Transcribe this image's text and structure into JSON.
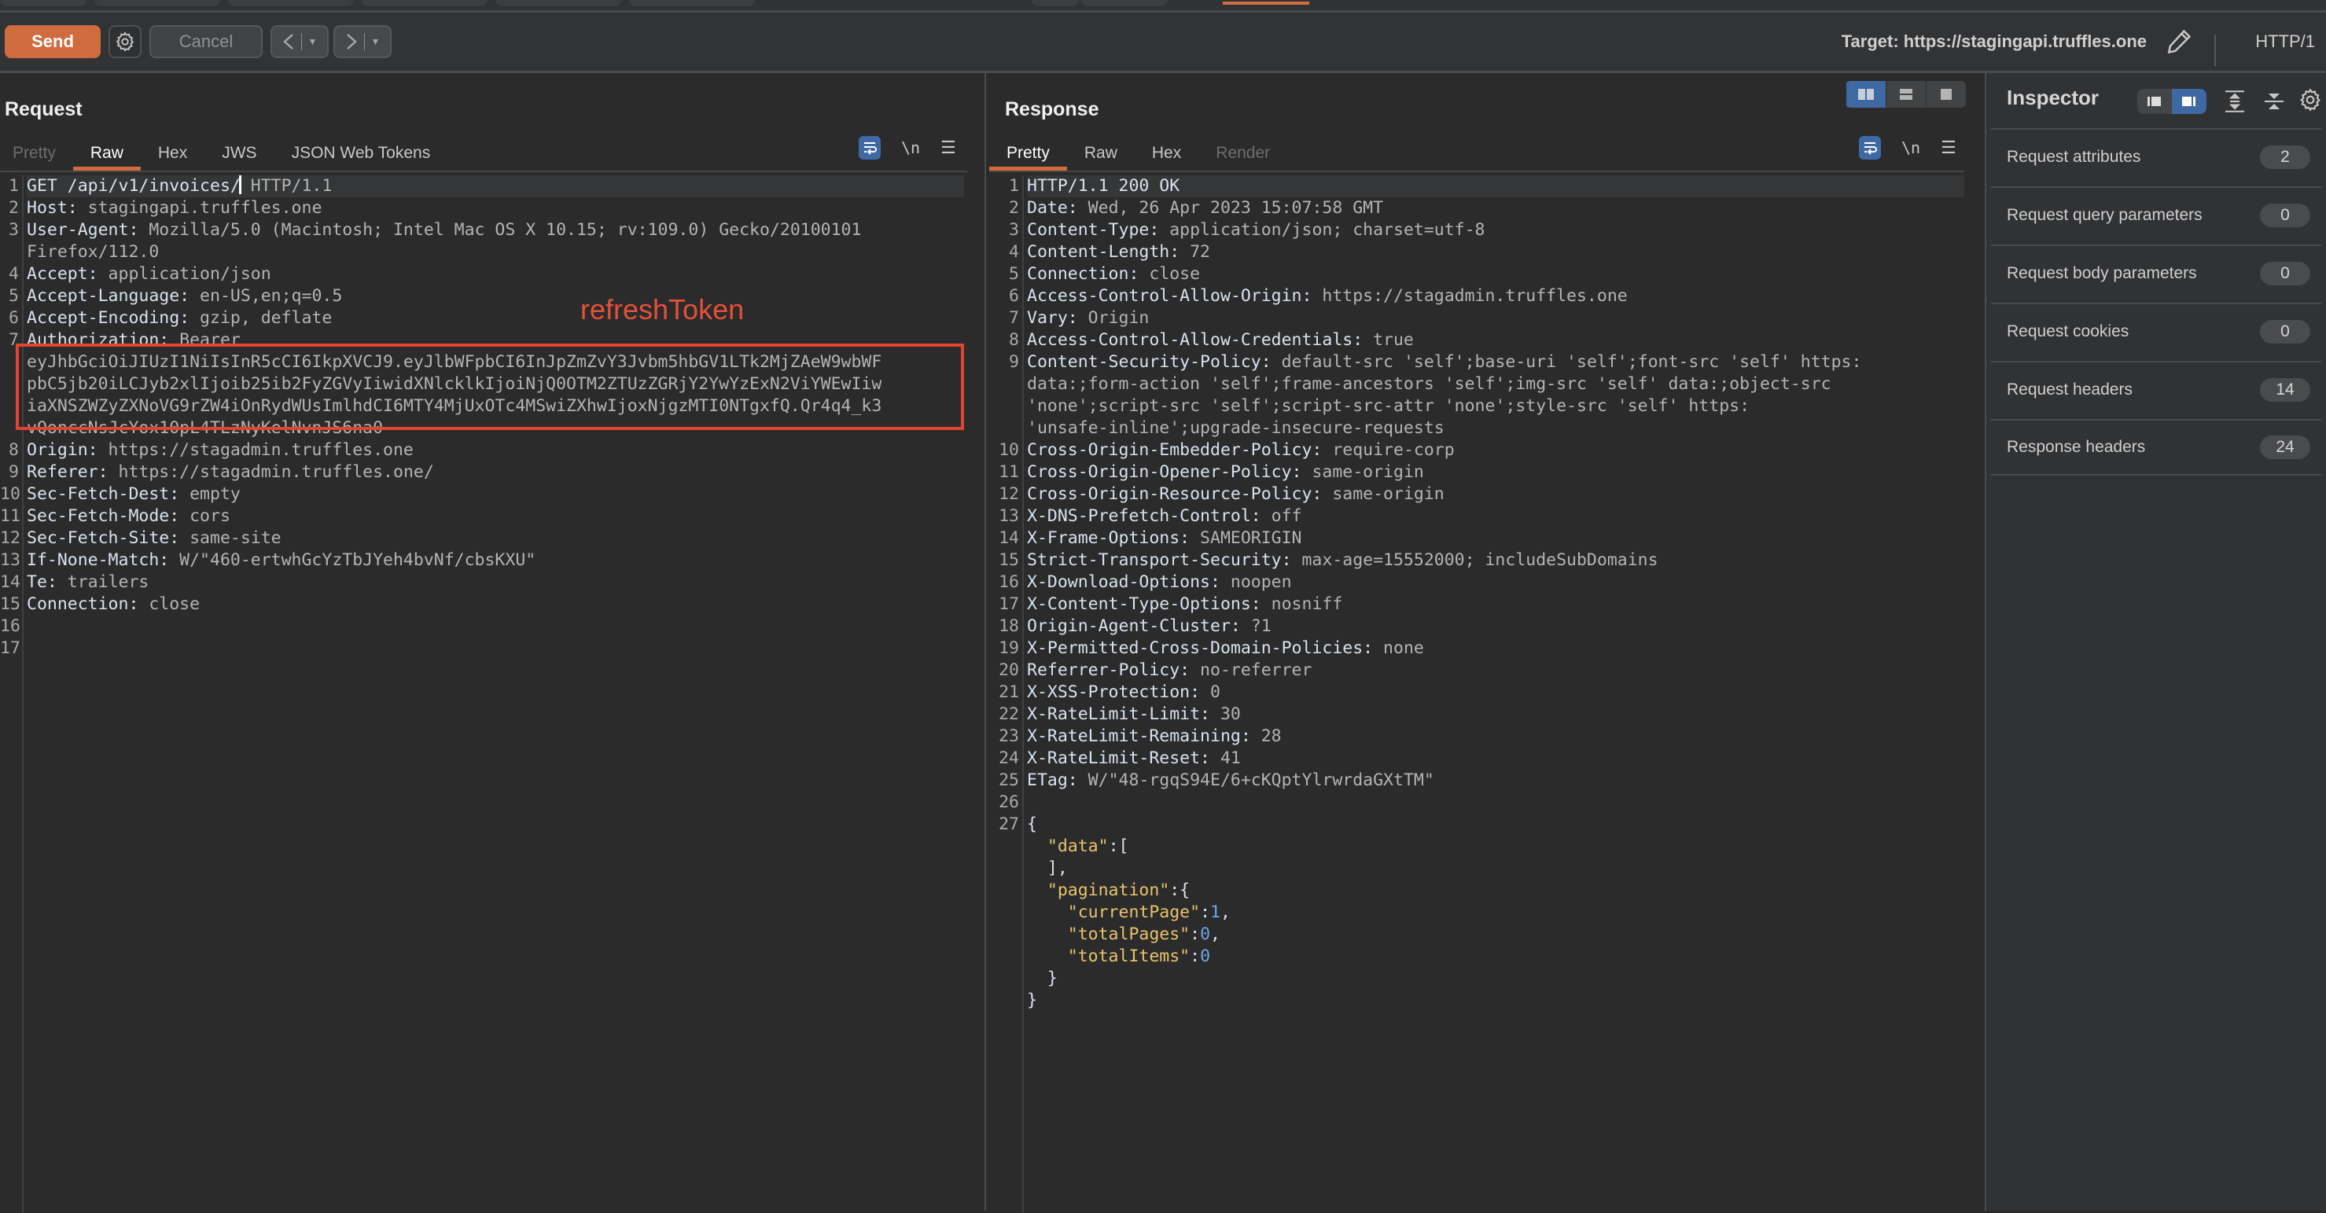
{
  "top_tabs": {
    "count": 7
  },
  "toolbar": {
    "send_label": "Send",
    "settings_icon": "gear-icon",
    "cancel_label": "Cancel",
    "back_icon": "chevron-left-icon",
    "forward_icon": "chevron-right-icon",
    "dropdown_icon": "caret-down-icon",
    "target_label": "Target: https://stagingapi.truffles.one",
    "edit_icon": "pencil-icon",
    "protocol": "HTTP/1"
  },
  "request": {
    "title": "Request",
    "tabs": [
      {
        "label": "Pretty",
        "state": "disabled"
      },
      {
        "label": "Raw",
        "state": "active"
      },
      {
        "label": "Hex",
        "state": "normal"
      },
      {
        "label": "JWS",
        "state": "normal"
      },
      {
        "label": "JSON Web Tokens",
        "state": "normal"
      }
    ],
    "tools": {
      "wrap_icon": "wrap-lines-icon",
      "newline_label": "\\n",
      "menu_icon": "hamburger-menu-icon"
    },
    "annotation": "refreshToken",
    "lines": [
      {
        "n": "1",
        "key": "GET /api/v1/invoices/",
        "val": " HTTP/1.1",
        "cursor": true,
        "current": true
      },
      {
        "n": "2",
        "key": "Host:",
        "val": " stagingapi.truffles.one"
      },
      {
        "n": "3",
        "key": "User-Agent:",
        "val": " Mozilla/5.0 (Macintosh; Intel Mac OS X 10.15; rv:109.0) Gecko/20100101"
      },
      {
        "n": "",
        "key": "",
        "val": "Firefox/112.0"
      },
      {
        "n": "4",
        "key": "Accept:",
        "val": " application/json"
      },
      {
        "n": "5",
        "key": "Accept-Language:",
        "val": " en-US,en;q=0.5"
      },
      {
        "n": "6",
        "key": "Accept-Encoding:",
        "val": " gzip, deflate"
      },
      {
        "n": "7",
        "key": "Authorization:",
        "val": " Bearer"
      },
      {
        "n": "",
        "key": "",
        "val": "eyJhbGciOiJIUzI1NiIsInR5cCI6IkpXVCJ9.eyJlbWFpbCI6InJpZmZvY3Jvbm5hbGV1LTk2MjZAeW9wbWF"
      },
      {
        "n": "",
        "key": "",
        "val": "pbC5jb20iLCJyb2xlIjoib25ib2FyZGVyIiwidXNlcklkIjoiNjQ0OTM2ZTUzZGRjY2YwYzExN2ViYWEwIiw"
      },
      {
        "n": "",
        "key": "",
        "val": "iaXNSZWZyZXNoVG9rZW4iOnRydWUsImlhdCI6MTY4MjUxOTc4MSwiZXhwIjoxNjgzMTI0NTgxfQ.Qr4q4_k3"
      },
      {
        "n": "",
        "key": "",
        "val": "vQonccNsJcYox10pL4TLzNyKelNvnJS6na0"
      },
      {
        "n": "8",
        "key": "Origin:",
        "val": " https://stagadmin.truffles.one"
      },
      {
        "n": "9",
        "key": "Referer:",
        "val": " https://stagadmin.truffles.one/"
      },
      {
        "n": "10",
        "key": "Sec-Fetch-Dest:",
        "val": " empty"
      },
      {
        "n": "11",
        "key": "Sec-Fetch-Mode:",
        "val": " cors"
      },
      {
        "n": "12",
        "key": "Sec-Fetch-Site:",
        "val": " same-site"
      },
      {
        "n": "13",
        "key": "If-None-Match:",
        "val": " W/\"460-ertwhGcYzTbJYeh4bvNf/cbsKXU\""
      },
      {
        "n": "14",
        "key": "Te:",
        "val": " trailers"
      },
      {
        "n": "15",
        "key": "Connection:",
        "val": " close"
      },
      {
        "n": "16",
        "key": "",
        "val": ""
      },
      {
        "n": "17",
        "key": "",
        "val": ""
      }
    ]
  },
  "response": {
    "title": "Response",
    "view_toggle": [
      {
        "name": "split-horizontal-icon",
        "on": true
      },
      {
        "name": "split-vertical-icon",
        "on": false
      },
      {
        "name": "single-pane-icon",
        "on": false
      }
    ],
    "tabs": [
      {
        "label": "Pretty",
        "state": "active"
      },
      {
        "label": "Raw",
        "state": "normal"
      },
      {
        "label": "Hex",
        "state": "normal"
      },
      {
        "label": "Render",
        "state": "disabled"
      }
    ],
    "tools": {
      "wrap_icon": "wrap-lines-icon",
      "newline_label": "\\n",
      "menu_icon": "hamburger-menu-icon"
    },
    "lines": [
      {
        "n": "1",
        "key": "HTTP/1.1 200 OK",
        "val": "",
        "current": true
      },
      {
        "n": "2",
        "key": "Date:",
        "val": " Wed, 26 Apr 2023 15:07:58 GMT"
      },
      {
        "n": "3",
        "key": "Content-Type:",
        "val": " application/json; charset=utf-8"
      },
      {
        "n": "4",
        "key": "Content-Length:",
        "val": " 72"
      },
      {
        "n": "5",
        "key": "Connection:",
        "val": " close"
      },
      {
        "n": "6",
        "key": "Access-Control-Allow-Origin:",
        "val": " https://stagadmin.truffles.one"
      },
      {
        "n": "7",
        "key": "Vary:",
        "val": " Origin"
      },
      {
        "n": "8",
        "key": "Access-Control-Allow-Credentials:",
        "val": " true"
      },
      {
        "n": "9",
        "key": "Content-Security-Policy:",
        "val": " default-src 'self';base-uri 'self';font-src 'self' https:"
      },
      {
        "n": "",
        "key": "",
        "val": "data:;form-action 'self';frame-ancestors 'self';img-src 'self' data:;object-src"
      },
      {
        "n": "",
        "key": "",
        "val": "'none';script-src 'self';script-src-attr 'none';style-src 'self' https:"
      },
      {
        "n": "",
        "key": "",
        "val": "'unsafe-inline';upgrade-insecure-requests"
      },
      {
        "n": "10",
        "key": "Cross-Origin-Embedder-Policy:",
        "val": " require-corp"
      },
      {
        "n": "11",
        "key": "Cross-Origin-Opener-Policy:",
        "val": " same-origin"
      },
      {
        "n": "12",
        "key": "Cross-Origin-Resource-Policy:",
        "val": " same-origin"
      },
      {
        "n": "13",
        "key": "X-DNS-Prefetch-Control:",
        "val": " off"
      },
      {
        "n": "14",
        "key": "X-Frame-Options:",
        "val": " SAMEORIGIN"
      },
      {
        "n": "15",
        "key": "Strict-Transport-Security:",
        "val": " max-age=15552000; includeSubDomains"
      },
      {
        "n": "16",
        "key": "X-Download-Options:",
        "val": " noopen"
      },
      {
        "n": "17",
        "key": "X-Content-Type-Options:",
        "val": " nosniff"
      },
      {
        "n": "18",
        "key": "Origin-Agent-Cluster:",
        "val": " ?1"
      },
      {
        "n": "19",
        "key": "X-Permitted-Cross-Domain-Policies:",
        "val": " none"
      },
      {
        "n": "20",
        "key": "Referrer-Policy:",
        "val": " no-referrer"
      },
      {
        "n": "21",
        "key": "X-XSS-Protection:",
        "val": " 0"
      },
      {
        "n": "22",
        "key": "X-RateLimit-Limit:",
        "val": " 30"
      },
      {
        "n": "23",
        "key": "X-RateLimit-Remaining:",
        "val": " 28"
      },
      {
        "n": "24",
        "key": "X-RateLimit-Reset:",
        "val": " 41"
      },
      {
        "n": "25",
        "key": "ETag:",
        "val": " W/\"48-rgqS94E/6+cKQptYlrwrdaGXtTM\""
      },
      {
        "n": "26",
        "key": "",
        "val": ""
      }
    ],
    "json_body": [
      {
        "n": "27",
        "parts": [
          [
            "p",
            "{"
          ]
        ]
      },
      {
        "n": "",
        "parts": [
          [
            "s",
            "  "
          ],
          [
            "k",
            "\"data\""
          ],
          [
            "p",
            ":["
          ]
        ]
      },
      {
        "n": "",
        "parts": [
          [
            "s",
            "  "
          ],
          [
            "p",
            "],"
          ]
        ]
      },
      {
        "n": "",
        "parts": [
          [
            "s",
            "  "
          ],
          [
            "k",
            "\"pagination\""
          ],
          [
            "p",
            ":{"
          ]
        ]
      },
      {
        "n": "",
        "parts": [
          [
            "s",
            "    "
          ],
          [
            "k",
            "\"currentPage\""
          ],
          [
            "p",
            ":"
          ],
          [
            "v",
            "1"
          ],
          [
            "p",
            ","
          ]
        ]
      },
      {
        "n": "",
        "parts": [
          [
            "s",
            "    "
          ],
          [
            "k",
            "\"totalPages\""
          ],
          [
            "p",
            ":"
          ],
          [
            "v",
            "0"
          ],
          [
            "p",
            ","
          ]
        ]
      },
      {
        "n": "",
        "parts": [
          [
            "s",
            "    "
          ],
          [
            "k",
            "\"totalItems\""
          ],
          [
            "p",
            ":"
          ],
          [
            "v",
            "0"
          ]
        ]
      },
      {
        "n": "",
        "parts": [
          [
            "s",
            "  "
          ],
          [
            "p",
            "}"
          ]
        ]
      },
      {
        "n": "",
        "parts": [
          [
            "p",
            "}"
          ]
        ]
      }
    ]
  },
  "inspector": {
    "title": "Inspector",
    "layout_toggle": [
      {
        "name": "dock-left-icon",
        "on": false
      },
      {
        "name": "dock-right-icon",
        "on": true
      }
    ],
    "expand_icon": "expand-all-icon",
    "collapse_icon": "collapse-all-icon",
    "settings_icon": "gear-icon",
    "rows": [
      {
        "label": "Request attributes",
        "count": "2"
      },
      {
        "label": "Request query parameters",
        "count": "0"
      },
      {
        "label": "Request body parameters",
        "count": "0"
      },
      {
        "label": "Request cookies",
        "count": "0"
      },
      {
        "label": "Request headers",
        "count": "14"
      },
      {
        "label": "Response headers",
        "count": "24"
      }
    ]
  },
  "colors": {
    "accent_orange": "#cf6b3e",
    "selected_blue": "#3e69a3",
    "annotation_red": "#e2442f",
    "json_key": "#e8c36d",
    "json_number": "#6ba6e8"
  }
}
